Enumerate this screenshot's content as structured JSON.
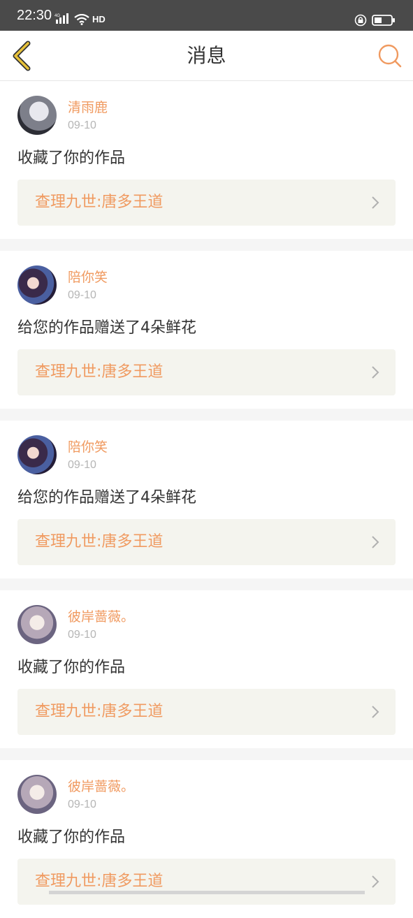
{
  "status_bar": {
    "time": "22:30",
    "network": "4G",
    "hd": "HD",
    "icons": [
      "signal-icon",
      "wifi-icon",
      "hd-icon",
      "rotation-lock-icon",
      "battery-icon"
    ]
  },
  "header": {
    "title": "消息",
    "back_icon": "chevron-left-icon",
    "search_icon": "search-icon"
  },
  "colors": {
    "accent": "#f09a60",
    "back_icon": "#e8c23a",
    "text": "#333333",
    "date": "#b5b5b5",
    "card_bg": "#f4f4ee"
  },
  "messages": [
    {
      "name": "清雨鹿",
      "date": "09-10",
      "text": "收藏了你的作品",
      "work": "查理九世:唐多王道"
    },
    {
      "name": "陪你笑",
      "date": "09-10",
      "text": "给您的作品赠送了4朵鲜花",
      "work": "查理九世:唐多王道"
    },
    {
      "name": "陪你笑",
      "date": "09-10",
      "text": "给您的作品赠送了4朵鲜花",
      "work": "查理九世:唐多王道"
    },
    {
      "name": "彼岸蔷薇。",
      "date": "09-10",
      "text": "收藏了你的作品",
      "work": "查理九世:唐多王道"
    },
    {
      "name": "彼岸蔷薇。",
      "date": "09-10",
      "text": "收藏了你的作品",
      "work": "查理九世:唐多王道"
    }
  ]
}
